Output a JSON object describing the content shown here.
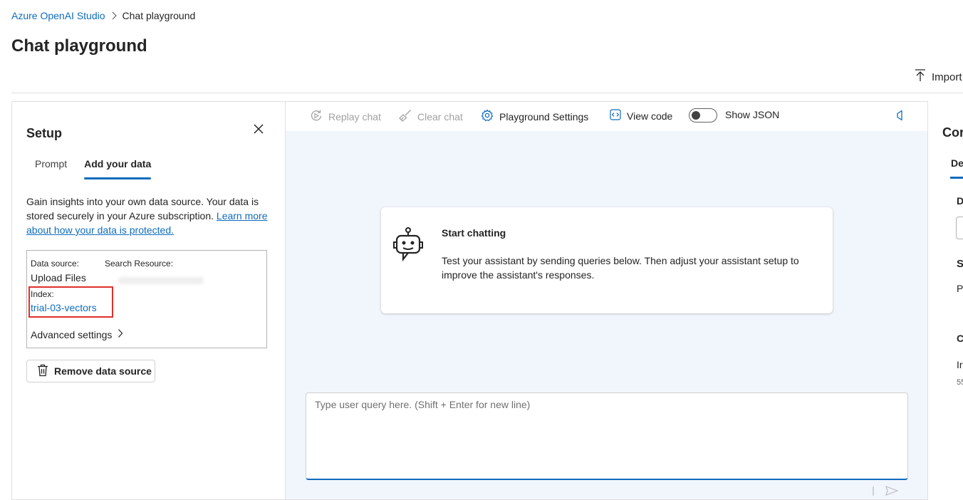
{
  "breadcrumb": {
    "root": "Azure OpenAI Studio",
    "current": "Chat playground"
  },
  "page": {
    "title": "Chat playground",
    "import_label": "Import"
  },
  "setup": {
    "title": "Setup",
    "tabs": [
      {
        "label": "Prompt"
      },
      {
        "label": "Add your data"
      }
    ],
    "description": "Gain insights into your own data source. Your data is stored securely in your Azure subscription. ",
    "learn_more": "Learn more about how your data is protected.",
    "data_source_label": "Data source:",
    "data_source_value": "Upload Files",
    "search_resource_label": "Search Resource:",
    "index_label": "Index:",
    "index_value": "trial-03-vectors",
    "advanced_settings": "Advanced settings",
    "remove_button": "Remove data source"
  },
  "toolbar": {
    "replay": "Replay chat",
    "clear": "Clear chat",
    "settings": "Playground Settings",
    "view_code": "View code",
    "show_json": "Show JSON",
    "show_json_on": false
  },
  "chat": {
    "card_title": "Start chatting",
    "card_text": "Test your assistant by sending queries below. Then adjust your assistant setup to improve the assistant's responses.",
    "query_placeholder": "Type user query here. (Shift + Enter for new line)"
  },
  "right_panel": {
    "title_partial": "Cor",
    "tab_partial": "De",
    "label_d": "D",
    "label_s": "S",
    "label_pa": "Pa",
    "label_c": "C",
    "label_ir": "Ir",
    "label_num": "55"
  },
  "colors": {
    "accent": "#0f6cbd",
    "highlight": "#e0302a",
    "chat_bg": "#f1f5fc"
  }
}
